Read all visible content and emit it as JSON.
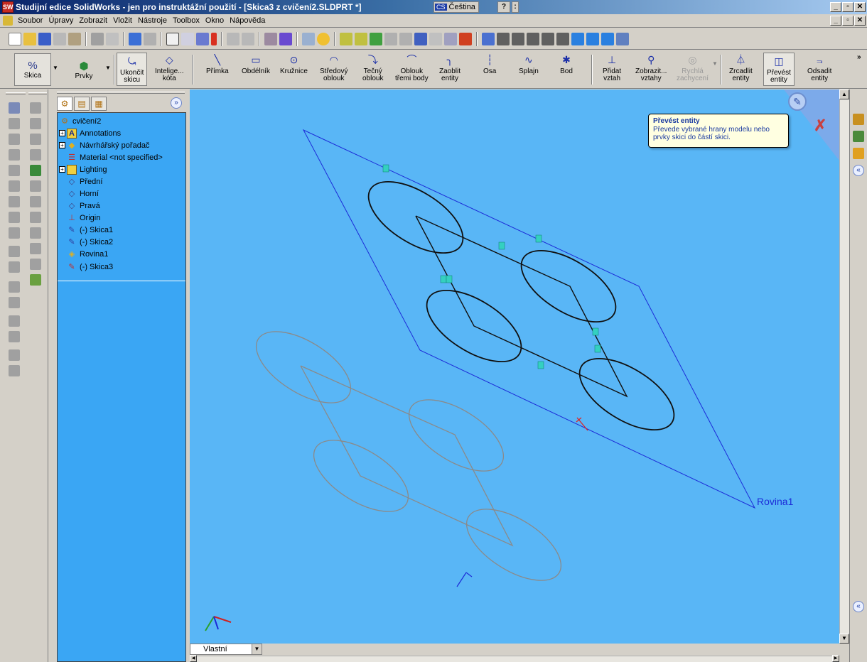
{
  "window": {
    "title": "Studijní edice SolidWorks - jen pro instruktážní použití - [Skica3 z cvičení2.SLDPRT *]",
    "language_code": "CS",
    "language": "Čeština",
    "help": "?"
  },
  "menu": [
    "Soubor",
    "Úpravy",
    "Zobrazit",
    "Vložit",
    "Nástroje",
    "Toolbox",
    "Okno",
    "Nápověda"
  ],
  "command_manager": {
    "modes": [
      "Skica",
      "Prvky"
    ],
    "commands": [
      {
        "id": "exit-sketch",
        "label": "Ukončit\nskicu"
      },
      {
        "id": "smart-dim",
        "label": "Intelige...\nkóta"
      },
      {
        "id": "line",
        "label": "Přímka"
      },
      {
        "id": "rectangle",
        "label": "Obdélník"
      },
      {
        "id": "circle",
        "label": "Kružnice"
      },
      {
        "id": "center-arc",
        "label": "Středový\noblouk"
      },
      {
        "id": "tangent-arc",
        "label": "Tečný\noblouk"
      },
      {
        "id": "three-point-arc",
        "label": "Oblouk\ntřemi body"
      },
      {
        "id": "fillet",
        "label": "Zaoblit\nentity"
      },
      {
        "id": "centerline",
        "label": "Osa"
      },
      {
        "id": "spline",
        "label": "Splajn"
      },
      {
        "id": "point",
        "label": "Bod"
      },
      {
        "id": "add-relation",
        "label": "Přidat\nvztah"
      },
      {
        "id": "show-relations",
        "label": "Zobrazit...\nvztahy"
      },
      {
        "id": "quick-snaps",
        "label": "Rychlá\nzachycení"
      },
      {
        "id": "mirror",
        "label": "Zrcadlit\nentity"
      },
      {
        "id": "convert",
        "label": "Převést\nentity"
      },
      {
        "id": "offset",
        "label": "Odsadit\nentity"
      }
    ]
  },
  "tree": {
    "root": "cvičení2",
    "items": [
      {
        "label": "Annotations"
      },
      {
        "label": "Návrhářský pořadač"
      },
      {
        "label": "Material <not specified>"
      },
      {
        "label": "Lighting"
      },
      {
        "label": "Přední"
      },
      {
        "label": "Horní"
      },
      {
        "label": "Pravá"
      },
      {
        "label": "Origin"
      },
      {
        "label": "(-) Skica1"
      },
      {
        "label": "(-) Skica2"
      },
      {
        "label": "Rovina1"
      },
      {
        "label": "(-) Skica3"
      }
    ]
  },
  "tooltip": {
    "title": "Převést entity",
    "body": "Převede vybrané hrany modelu nebo prvky skici do částí skici."
  },
  "viewport": {
    "plane_label": "Rovina1",
    "view_orientation": "Vlastní",
    "background_color": "#59b6f6"
  }
}
